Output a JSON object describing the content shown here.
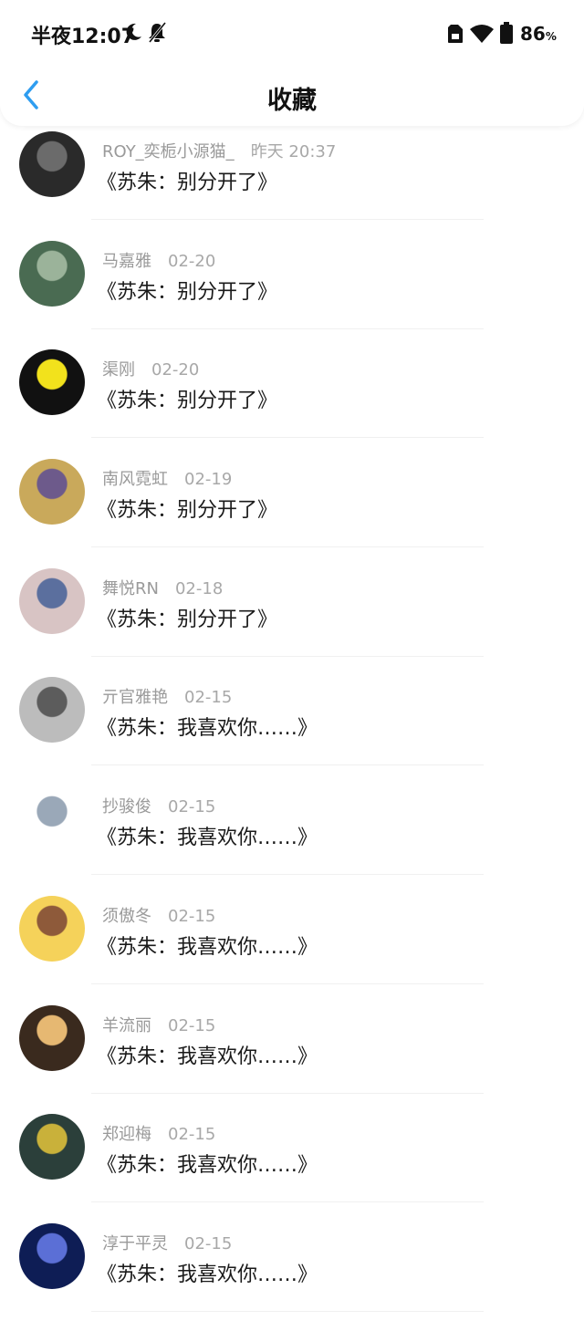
{
  "status_bar": {
    "time": "半夜12:07",
    "battery": "86",
    "battery_unit": "%"
  },
  "header": {
    "title": "收藏",
    "accent_color": "#2e9df0"
  },
  "items": [
    {
      "user": "ROY_奕栀小源猫_",
      "date": "昨天 20:37",
      "text": "《苏朱：别分开了》",
      "avatar_colors": [
        "#2a2a2a",
        "#6b6b6b"
      ]
    },
    {
      "user": "马嘉雅",
      "date": "02-20",
      "text": "《苏朱：别分开了》",
      "avatar_colors": [
        "#4a6b52",
        "#9bb39a"
      ]
    },
    {
      "user": "渠刚",
      "date": "02-20",
      "text": "《苏朱：别分开了》",
      "avatar_colors": [
        "#111111",
        "#f2e21c"
      ]
    },
    {
      "user": "南风霓虹",
      "date": "02-19",
      "text": "《苏朱：别分开了》",
      "avatar_colors": [
        "#c9a95b",
        "#6d5a8b"
      ]
    },
    {
      "user": "舞悦RN",
      "date": "02-18",
      "text": "《苏朱：别分开了》",
      "avatar_colors": [
        "#d8c4c4",
        "#5b6f9e"
      ]
    },
    {
      "user": "亓官雅艳",
      "date": "02-15",
      "text": "《苏朱：我喜欢你……》",
      "avatar_colors": [
        "#bcbcbc",
        "#5c5c5c"
      ]
    },
    {
      "user": "抄骏俊",
      "date": "02-15",
      "text": "《苏朱：我喜欢你……》",
      "avatar_colors": [
        "#ffffff",
        "#9aa8b8"
      ]
    },
    {
      "user": "须傲冬",
      "date": "02-15",
      "text": "《苏朱：我喜欢你……》",
      "avatar_colors": [
        "#f5d25a",
        "#8e5a3a"
      ]
    },
    {
      "user": "羊流丽",
      "date": "02-15",
      "text": "《苏朱：我喜欢你……》",
      "avatar_colors": [
        "#3a2a1e",
        "#e6b872"
      ]
    },
    {
      "user": "郑迎梅",
      "date": "02-15",
      "text": "《苏朱：我喜欢你……》",
      "avatar_colors": [
        "#2b3f3a",
        "#c9b13a"
      ]
    },
    {
      "user": "淳于平灵",
      "date": "02-15",
      "text": "《苏朱：我喜欢你……》",
      "avatar_colors": [
        "#0e1d55",
        "#5b6fd6"
      ]
    }
  ]
}
